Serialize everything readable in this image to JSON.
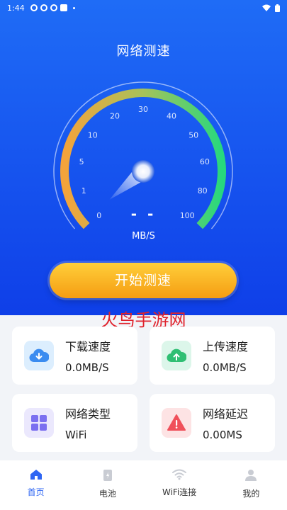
{
  "status_bar": {
    "time": "1:44"
  },
  "page_title": "网络测速",
  "gauge": {
    "ticks": [
      "0",
      "1",
      "5",
      "10",
      "20",
      "30",
      "40",
      "50",
      "60",
      "80",
      "100"
    ],
    "value_display": "- -",
    "unit": "MB/S",
    "needle_value": 0,
    "colors": {
      "start": "#f4a33b",
      "end": "#27d87e"
    }
  },
  "start_button": {
    "label": "开始测速"
  },
  "watermark": "火鸟手游网",
  "cards": {
    "download": {
      "label": "下载速度",
      "value": "0.0MB/S",
      "icon": "download-cloud-icon",
      "color": "#3b8cf0",
      "bg": "#dceefe"
    },
    "upload": {
      "label": "上传速度",
      "value": "0.0MB/S",
      "icon": "upload-cloud-icon",
      "color": "#2fbf73",
      "bg": "#dcf6ea"
    },
    "network_type": {
      "label": "网络类型",
      "value": "WiFi",
      "icon": "grid-icon",
      "color": "#7b6ff0",
      "bg": "#ebe8fd"
    },
    "latency": {
      "label": "网络延迟",
      "value": "0.00MS",
      "icon": "warning-icon",
      "color": "#f0505a",
      "bg": "#fde3e4"
    }
  },
  "tabs": [
    {
      "label": "首页",
      "icon": "home-icon",
      "active": true
    },
    {
      "label": "电池",
      "icon": "battery-icon",
      "active": false
    },
    {
      "label": "WiFi连接",
      "icon": "wifi-icon",
      "active": false
    },
    {
      "label": "我的",
      "icon": "person-icon",
      "active": false
    }
  ],
  "accent_color": "#2f66f3"
}
